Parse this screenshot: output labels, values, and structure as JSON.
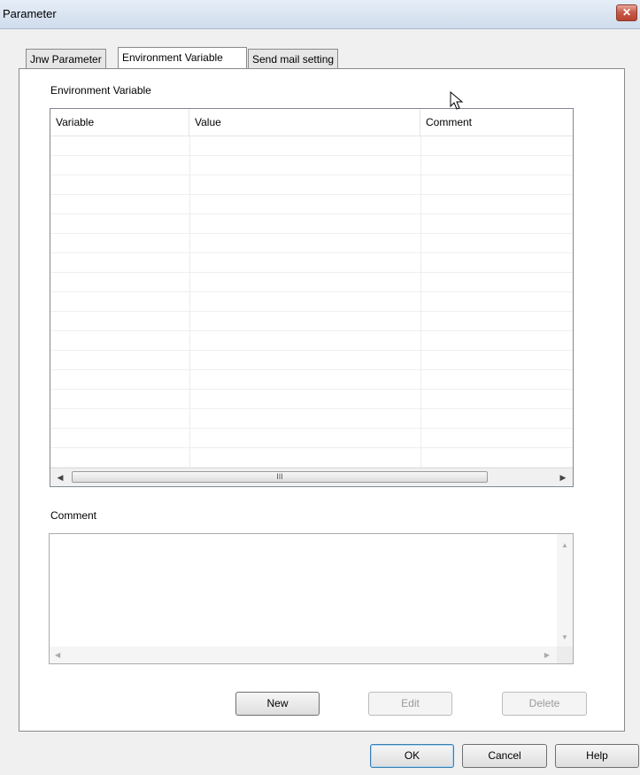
{
  "window": {
    "title": "Parameter",
    "close_glyph": "✕"
  },
  "tabs": [
    {
      "label": "Jnw Parameter",
      "active": false
    },
    {
      "label": "Environment Variable",
      "active": true
    },
    {
      "label": "Send mail setting",
      "active": false
    }
  ],
  "env_section": {
    "label": "Environment Variable"
  },
  "table": {
    "columns": [
      "Variable",
      "Value",
      "Comment"
    ],
    "rows": [],
    "scroll_thumb_glyph": "III"
  },
  "comment_section": {
    "label": "Comment",
    "value": ""
  },
  "actions": {
    "new_label": "New",
    "edit_label": "Edit",
    "delete_label": "Delete"
  },
  "footer": {
    "ok_label": "OK",
    "cancel_label": "Cancel",
    "help_label": "Help"
  },
  "icons": {
    "close": "close-icon",
    "scroll_left": "chevron-left-icon",
    "scroll_right": "chevron-right-icon",
    "scroll_up": "chevron-up-icon",
    "scroll_down": "chevron-down-icon",
    "cursor": "mouse-cursor-icon"
  }
}
